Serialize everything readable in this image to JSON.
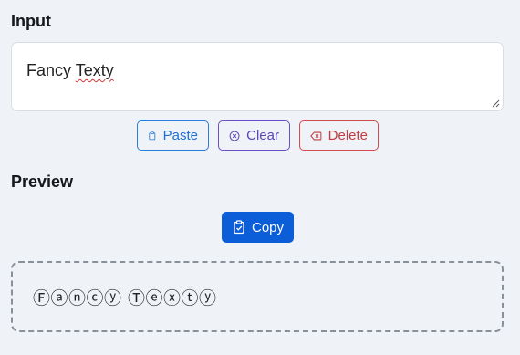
{
  "input": {
    "title": "Input",
    "value_word1": "Fancy ",
    "value_word2": "Texty"
  },
  "actions": {
    "paste_label": "Paste",
    "clear_label": "Clear",
    "delete_label": "Delete"
  },
  "preview": {
    "title": "Preview",
    "copy_label": "Copy",
    "output": "Ⓕⓐⓝⓒⓨ Ⓣⓔⓧⓣⓨ"
  },
  "colors": {
    "background": "#eff3f8",
    "paste": "#2b7cdb",
    "clear": "#6a4fc8",
    "delete": "#d24a4f",
    "copy_bg": "#0b5ed7"
  },
  "icons": {
    "paste": "clipboard-icon",
    "clear": "circle-x-icon",
    "delete": "backspace-icon",
    "copy": "clipboard-check-icon"
  }
}
